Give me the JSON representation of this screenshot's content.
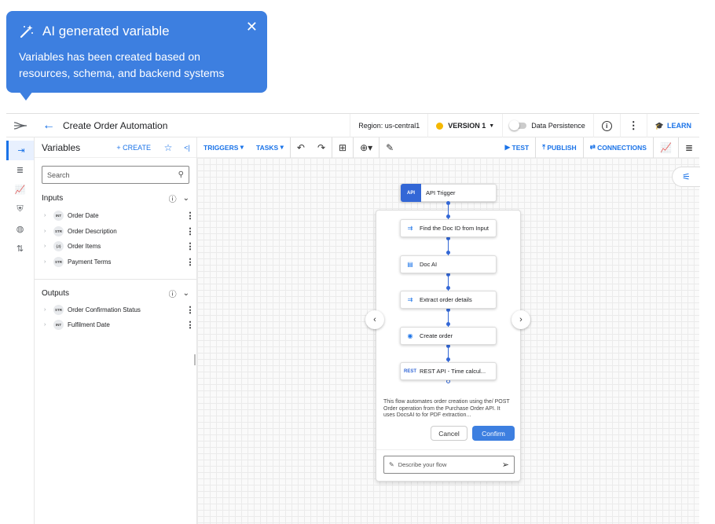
{
  "tooltip": {
    "title": "AI generated variable",
    "body_line1": "Variables has been created based on",
    "body_line2": "resources, schema, and backend systems",
    "close": "✕"
  },
  "topbar": {
    "title": "Create Order Automation",
    "region": "Region: us-central1",
    "version": "VERSION 1",
    "data_persistence": "Data Persistence",
    "learn": "LEARN"
  },
  "panel": {
    "title": "Variables",
    "create": "CREATE",
    "search_placeholder": "Search",
    "inputs_label": "Inputs",
    "outputs_label": "Outputs",
    "inputs": [
      {
        "type": "INT",
        "name": "Order Date"
      },
      {
        "type": "STR",
        "name": "Order Description"
      },
      {
        "type": "{J}",
        "name": "Order Items"
      },
      {
        "type": "STR",
        "name": "Payment Terms"
      }
    ],
    "outputs": [
      {
        "type": "STR",
        "name": "Order Confirmation Status"
      },
      {
        "type": "INT",
        "name": "Fulfilment Date"
      }
    ]
  },
  "toolbar": {
    "triggers": "TRIGGERS",
    "tasks": "TASKS",
    "test": "TEST",
    "publish": "PUBLISH",
    "connections": "CONNECTIONS"
  },
  "flow": {
    "nodes": [
      {
        "label": "API Trigger",
        "icon": "API"
      },
      {
        "label": "Find the Doc ID from Input",
        "icon": "⇉"
      },
      {
        "label": "Doc AI",
        "icon": "▤"
      },
      {
        "label": "Extract order details",
        "icon": "⇉"
      },
      {
        "label": "Create order",
        "icon": "◉"
      },
      {
        "label": "REST API - Time calcul...",
        "icon": "REST"
      }
    ],
    "description": "This flow automates order creation using the/ POST Order operation from the Purchase Order API. It uses DocsAI to for PDF extraction...",
    "cancel": "Cancel",
    "confirm": "Confirm",
    "prompt_placeholder": "Describe your flow"
  },
  "colors": {
    "accent": "#1a73e8",
    "tooltip_bg": "#3d7fe0",
    "version_dot": "#f5b800"
  }
}
